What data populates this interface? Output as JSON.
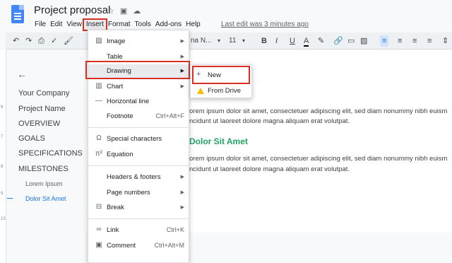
{
  "header": {
    "title": "Project proposal",
    "last_edit": "Last edit was 3 minutes ago",
    "menus": [
      "File",
      "Edit",
      "View",
      "Insert",
      "Format",
      "Tools",
      "Add-ons",
      "Help"
    ]
  },
  "toolbar": {
    "font": "na N...",
    "font_size": "11"
  },
  "outline": [
    {
      "label": "Your Company"
    },
    {
      "label": "Project Name"
    },
    {
      "label": "OVERVIEW"
    },
    {
      "label": "GOALS"
    },
    {
      "label": "SPECIFICATIONS"
    },
    {
      "label": "MILESTONES"
    },
    {
      "label": "Lorem Ipsum"
    },
    {
      "label": "Dolor Sit Amet"
    }
  ],
  "ruler_numbers": [
    "6",
    "7",
    "8",
    "9",
    "10"
  ],
  "document": {
    "para1_line1": "orem ipsum dolor sit amet, consectetuer adipiscing elit, sed diam nonummy nibh euism",
    "para1_line2": "ncidunt ut laoreet dolore magna aliquam erat volutpat.",
    "heading": "Dolor Sit Amet",
    "para2_line1": "orem ipsum dolor sit amet, consectetuer adipiscing elit, sed diam nonummy nibh euism",
    "para2_line2": "ncidunt ut laoreet dolore magna aliquam erat volutpat."
  },
  "insert_menu": [
    {
      "icon": "image-icon",
      "label": "Image",
      "shortcut": "",
      "arrow": true
    },
    {
      "icon": "",
      "label": "Table",
      "shortcut": "",
      "arrow": true
    },
    {
      "icon": "",
      "label": "Drawing",
      "shortcut": "",
      "arrow": true
    },
    {
      "icon": "chart-icon",
      "label": "Chart",
      "shortcut": "",
      "arrow": true
    },
    {
      "icon": "horizontal-line-icon",
      "label": "Horizontal line",
      "shortcut": "",
      "arrow": false
    },
    {
      "icon": "",
      "label": "Footnote",
      "shortcut": "Ctrl+Alt+F",
      "arrow": false
    },
    {
      "icon": "omega-icon",
      "label": "Special characters",
      "shortcut": "",
      "arrow": false
    },
    {
      "icon": "pi-icon",
      "label": "Equation",
      "shortcut": "",
      "arrow": false
    },
    {
      "icon": "",
      "label": "Headers & footers",
      "shortcut": "",
      "arrow": true
    },
    {
      "icon": "",
      "label": "Page numbers",
      "shortcut": "",
      "arrow": true
    },
    {
      "icon": "break-icon",
      "label": "Break",
      "shortcut": "",
      "arrow": true
    },
    {
      "icon": "link-icon",
      "label": "Link",
      "shortcut": "Ctrl+K",
      "arrow": false
    },
    {
      "icon": "comment-icon",
      "label": "Comment",
      "shortcut": "Ctrl+Alt+M",
      "arrow": false
    }
  ],
  "drawing_submenu": [
    {
      "icon": "plus-icon",
      "label": "New"
    },
    {
      "icon": "google-drive-icon",
      "label": "From Drive"
    }
  ],
  "colors": {
    "highlight": "#d93025",
    "accent": "#1a73e8",
    "heading": "#21a366"
  }
}
